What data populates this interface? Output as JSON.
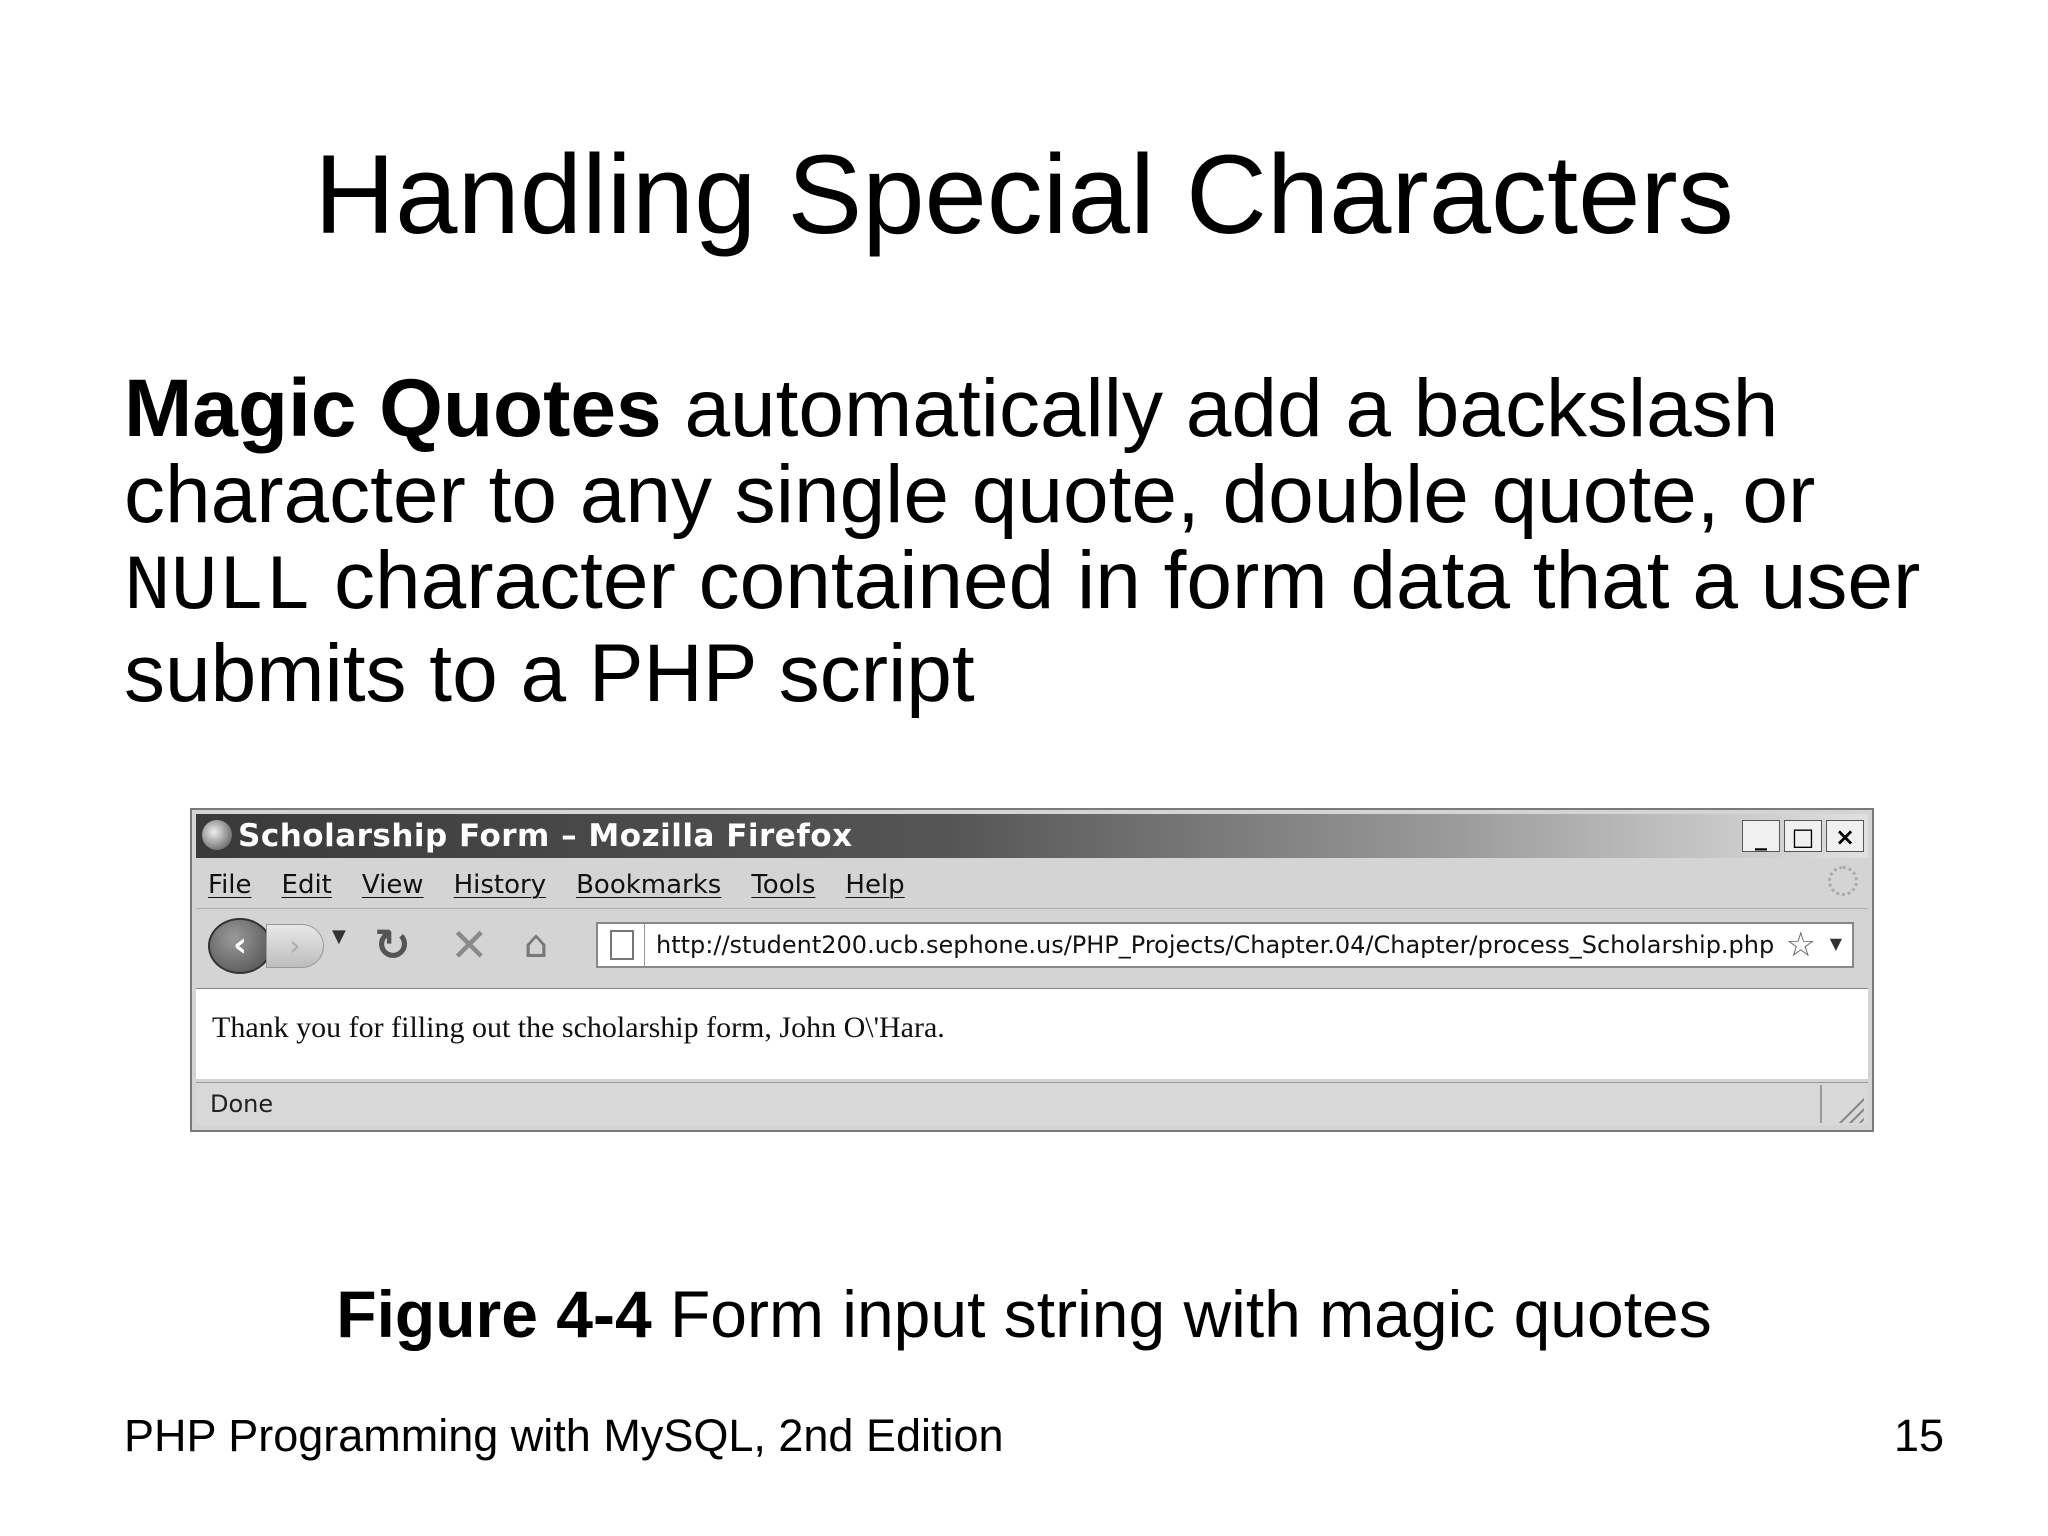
{
  "slide": {
    "title": "Handling Special Characters",
    "body": {
      "bold_term": "Magic Quotes",
      "text_1": " automatically add a backslash character to any single quote, double quote, or ",
      "code_term": "NULL",
      "text_2": " character contained in form data that a user submits to a PHP script"
    },
    "caption": {
      "label": "Figure 4-4",
      "text": " Form input string with magic quotes"
    },
    "footer": {
      "book": "PHP Programming with MySQL, 2nd Edition",
      "page_number": "15"
    }
  },
  "browser": {
    "window_title": "Scholarship Form – Mozilla Firefox",
    "window_buttons": {
      "minimize": "_",
      "maximize": "□",
      "close": "×"
    },
    "menu": [
      "File",
      "Edit",
      "View",
      "History",
      "Bookmarks",
      "Tools",
      "Help"
    ],
    "nav_glyphs": {
      "back": "‹",
      "forward": "›",
      "dropdown": "▼",
      "reload": "↻",
      "stop": "✕",
      "home": "⌂",
      "star": "☆"
    },
    "url": "http://student200.ucb.sephone.us/PHP_Projects/Chapter.04/Chapter/process_Scholarship.php",
    "page_text": "Thank you for filling out the scholarship form, John O\\'Hara.",
    "status": "Done"
  }
}
